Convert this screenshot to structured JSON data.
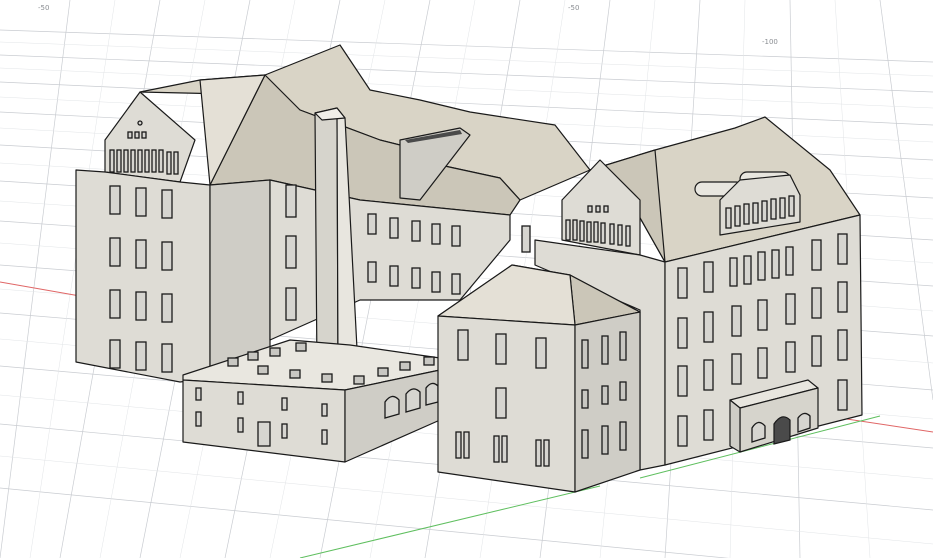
{
  "viewport": {
    "title": "",
    "background": "#ffffff",
    "grid_color": "#c9ccd1",
    "x_axis_color": "#e06666",
    "y_axis_color": "#5fbf5f",
    "model_face_light": "#dedcd5",
    "model_face_shade": "#cfcdc6",
    "roof_color": "#d9d4c6",
    "grid_labels": [
      "-50",
      "-50",
      "-100"
    ]
  },
  "model": {
    "name": "",
    "description_icon": "building-3d-model"
  }
}
